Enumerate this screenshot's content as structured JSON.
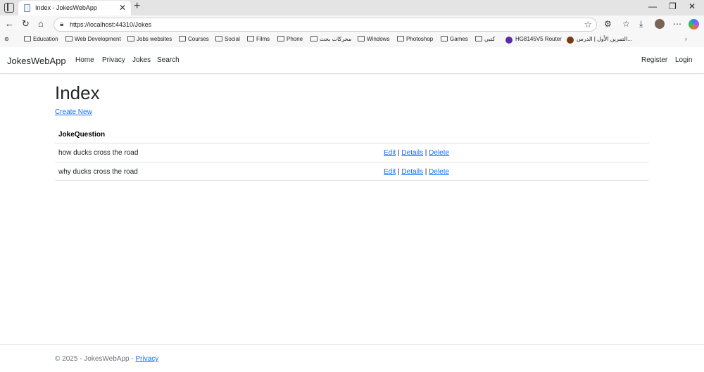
{
  "browser": {
    "tab_title": "Index - JokesWebApp",
    "url": "https://localhost:44310/Jokes",
    "bookmarks": [
      "Education",
      "Web Development",
      "Jobs websites",
      "Courses",
      "Social",
      "Films",
      "Phone",
      "محركات بحث",
      "Windows",
      "Photoshop",
      "Games",
      "كتبي",
      "HG8145V5 Router",
      "التمرين الأول | الدرس..."
    ]
  },
  "site": {
    "brand": "JokesWebApp",
    "nav": [
      "Home",
      "Privacy",
      "Jokes",
      "Search"
    ],
    "auth": [
      "Register",
      "Login"
    ]
  },
  "page": {
    "title": "Index",
    "create_link": "Create New",
    "column_header": "JokeQuestion",
    "rows": [
      {
        "question": "how ducks cross the road",
        "edit": "Edit",
        "details": "Details",
        "delete": "Delete"
      },
      {
        "question": "why ducks cross the road",
        "edit": "Edit",
        "details": "Details",
        "delete": "Delete"
      }
    ],
    "separator": "|"
  },
  "footer": {
    "text": "© 2025 - JokesWebApp -",
    "privacy": "Privacy"
  },
  "colors": {
    "link": "#0d6efd",
    "text": "#212529",
    "border": "#dee2e6"
  },
  "icons": [
    "back-icon",
    "refresh-icon",
    "home-icon",
    "lock-icon",
    "star-icon",
    "extensions-icon",
    "favorites-icon",
    "download-icon",
    "menu-icon"
  ]
}
